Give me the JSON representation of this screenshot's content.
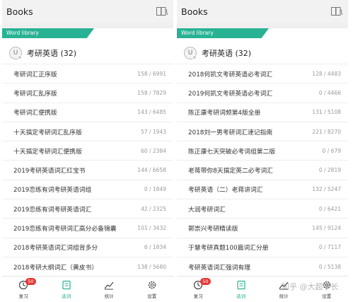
{
  "left": {
    "title": "Books",
    "ribbon": "Word library",
    "avatar_letter": "U",
    "group_title": "考研英语 (32)",
    "rows": [
      {
        "name": "考研词汇正序版",
        "count": "158 / 6991"
      },
      {
        "name": "考研词汇乱序版",
        "count": "158 / 7829"
      },
      {
        "name": "考研词汇便携版",
        "count": "143 / 6485"
      },
      {
        "name": "十天搞定考研词汇乱序版",
        "count": "57 / 1943"
      },
      {
        "name": "十天搞定考研词汇便携版",
        "count": "60 / 2384"
      },
      {
        "name": "2019考研英语词汇红宝书",
        "count": "144 / 6658"
      },
      {
        "name": "2019恋练有词考研英语词组",
        "count": "0 / 1849"
      },
      {
        "name": "2019恋练有词考研英语词汇",
        "count": "42 / 2325"
      },
      {
        "name": "2019恋练有词考研词汇高分必备锦囊",
        "count": "101 / 3432"
      },
      {
        "name": "2018考研英语词汇词组背多分",
        "count": "6 / 1834"
      },
      {
        "name": "2018考研大纲词汇（黄皮书）",
        "count": "138 / 5680"
      }
    ]
  },
  "right": {
    "title": "Books",
    "ribbon": "Word library",
    "avatar_letter": "U",
    "group_title": "考研英语 (32)",
    "rows": [
      {
        "name": "2018何凯文考研英语必考词汇",
        "count": "128 / 4483"
      },
      {
        "name": "2019何凯文考研英语必考词汇",
        "count": "0 / 4466"
      },
      {
        "name": "陈正康考研词频第4版全册",
        "count": "131 / 5108"
      },
      {
        "name": "2018刘一男考研词汇速记指南",
        "count": "221 / 8270"
      },
      {
        "name": "陈正康七天突破必考词组第二版",
        "count": "0 / 679"
      },
      {
        "name": "老蒋带你8天搞定英二必考词汇",
        "count": "0 / 2819"
      },
      {
        "name": "考研英语（二）老蒋讲词汇",
        "count": "132 / 5247"
      },
      {
        "name": "大润考研词汇",
        "count": "0 / 6421"
      },
      {
        "name": "郭崇兴考研精读版",
        "count": "145 / 9124"
      },
      {
        "name": "于慧考研真题100篇词汇分册",
        "count": "0 / 7117"
      },
      {
        "name": "考研英语词汇强词有理",
        "count": "0 / 5138"
      }
    ]
  },
  "tabs": [
    {
      "label": "复习",
      "icon": "review-clock-icon",
      "badge": "50"
    },
    {
      "label": "选词",
      "icon": "word-select-icon"
    },
    {
      "label": "统计",
      "icon": "statistics-chart-icon"
    },
    {
      "label": "设置",
      "icon": "settings-gear-icon"
    }
  ],
  "watermark": "知乎 @大超学长",
  "colors": {
    "accent": "#28b294",
    "badge": "#e53935",
    "background": "#efefef"
  }
}
